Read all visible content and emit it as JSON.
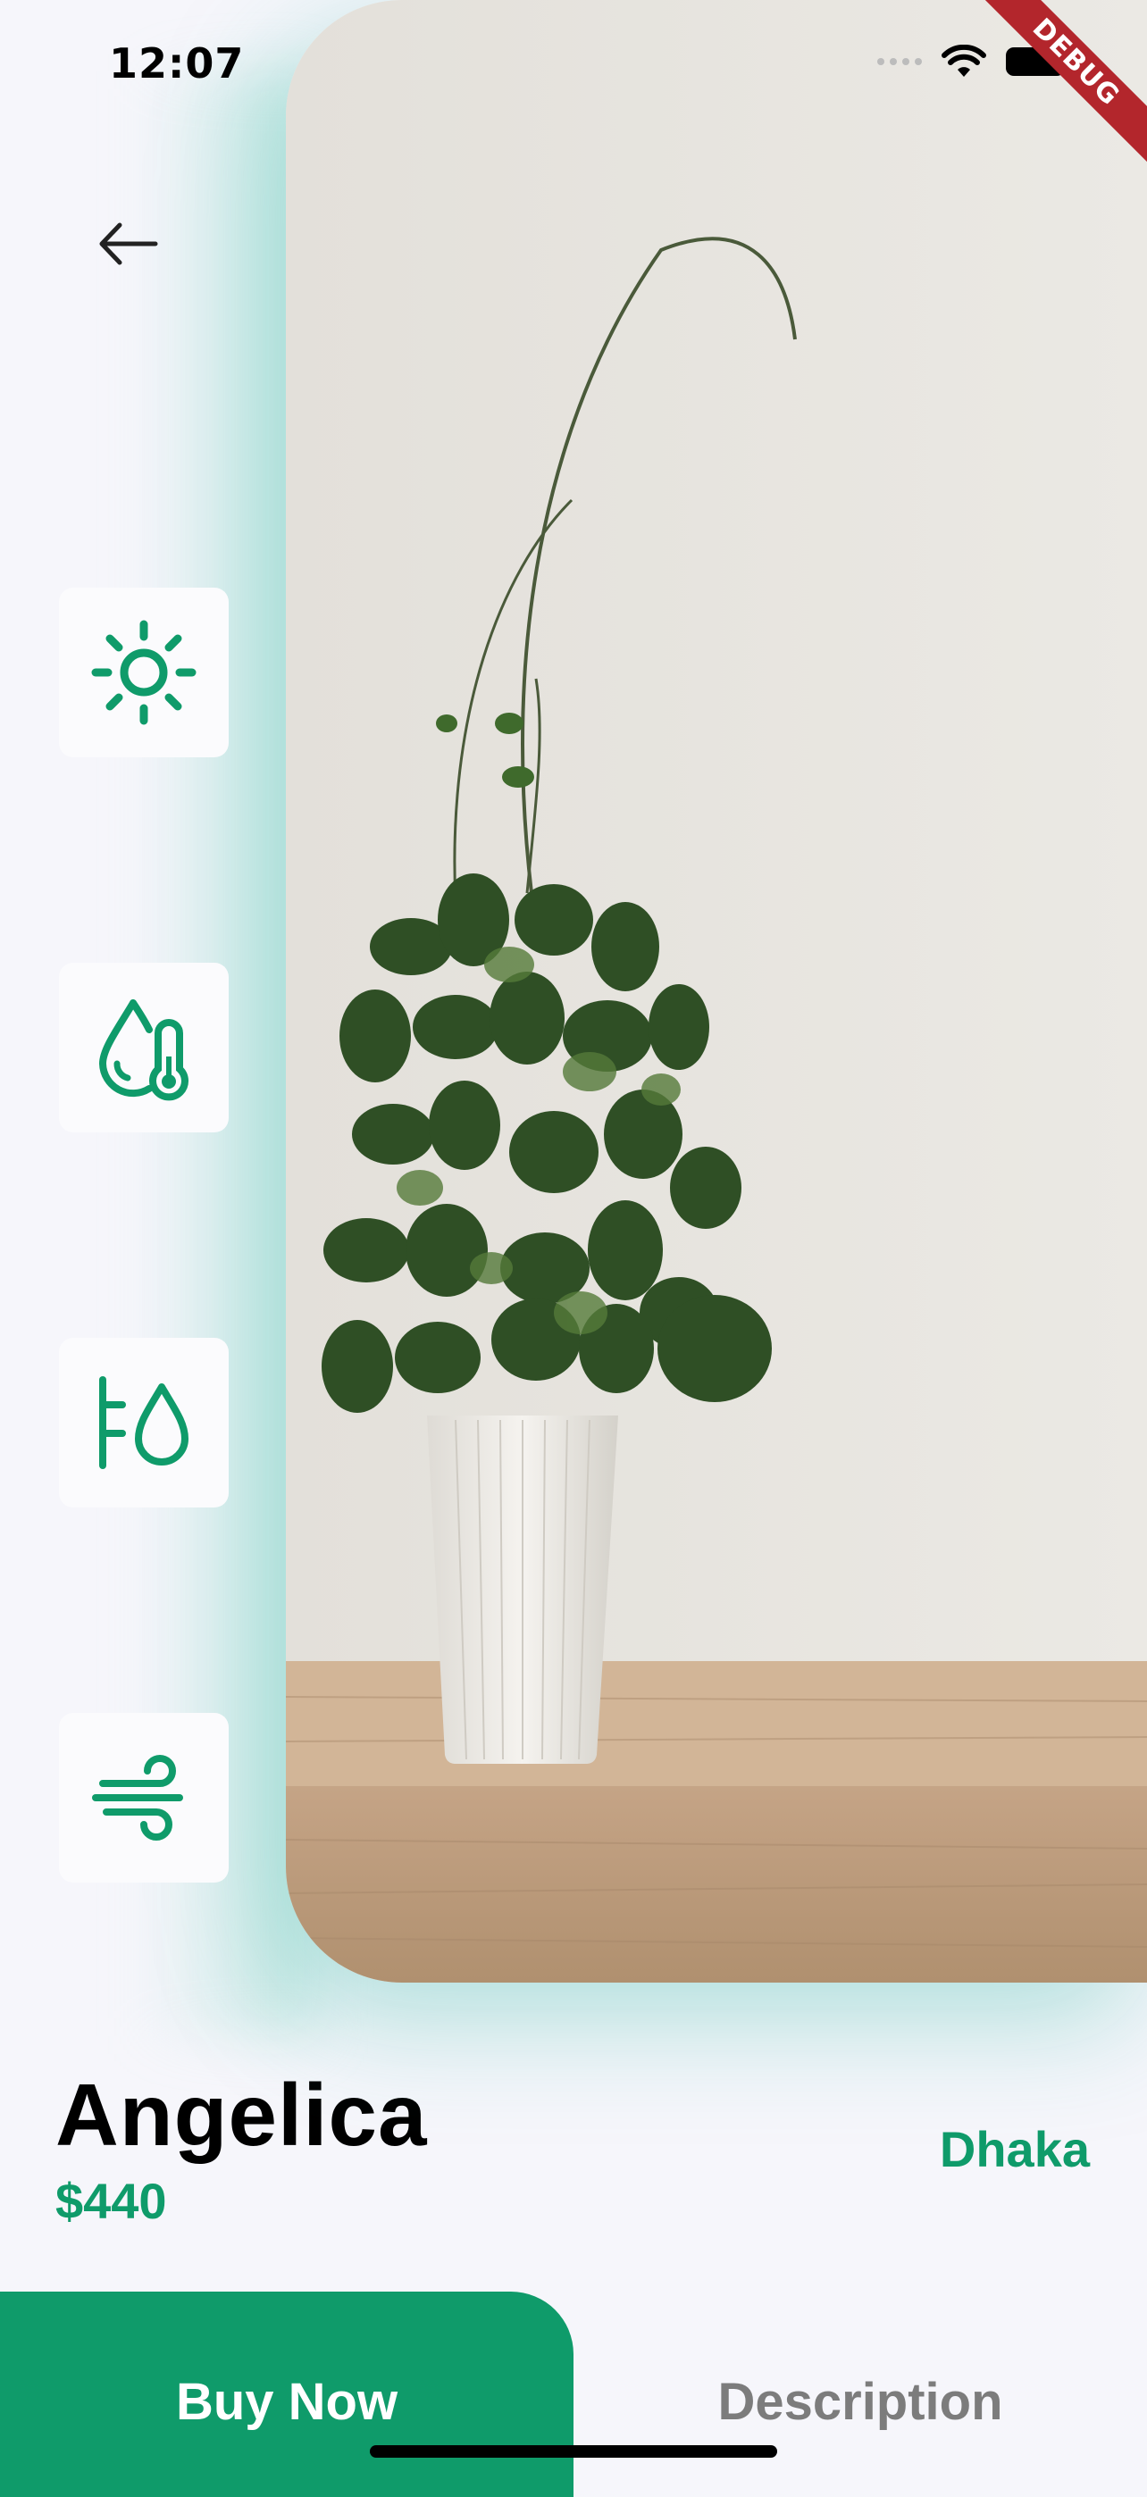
{
  "status_bar": {
    "time": "12:07"
  },
  "debug_banner": "DEBUG",
  "product": {
    "name": "Angelica",
    "price": "$440",
    "location": "Dhaka"
  },
  "features": [
    {
      "icon": "sun-icon"
    },
    {
      "icon": "humidity-thermometer-icon"
    },
    {
      "icon": "water-level-icon"
    },
    {
      "icon": "wind-icon"
    }
  ],
  "actions": {
    "buy_label": "Buy Now",
    "description_label": "Description"
  },
  "colors": {
    "accent": "#0f9b6a",
    "background": "#f6f6fb",
    "muted": "#7c7c7c"
  }
}
